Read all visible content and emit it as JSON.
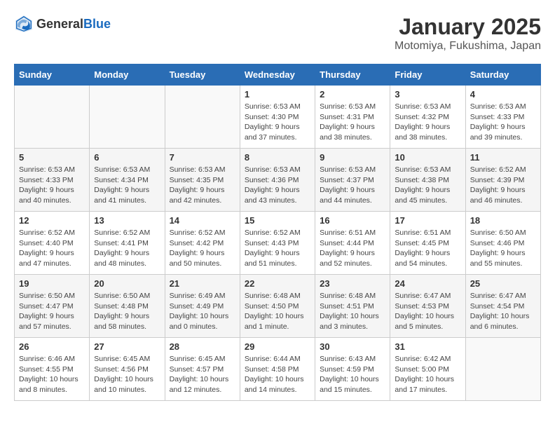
{
  "header": {
    "logo_general": "General",
    "logo_blue": "Blue",
    "month": "January 2025",
    "location": "Motomiya, Fukushima, Japan"
  },
  "days_of_week": [
    "Sunday",
    "Monday",
    "Tuesday",
    "Wednesday",
    "Thursday",
    "Friday",
    "Saturday"
  ],
  "weeks": [
    [
      {
        "day": "",
        "info": ""
      },
      {
        "day": "",
        "info": ""
      },
      {
        "day": "",
        "info": ""
      },
      {
        "day": "1",
        "info": "Sunrise: 6:53 AM\nSunset: 4:30 PM\nDaylight: 9 hours and 37 minutes."
      },
      {
        "day": "2",
        "info": "Sunrise: 6:53 AM\nSunset: 4:31 PM\nDaylight: 9 hours and 38 minutes."
      },
      {
        "day": "3",
        "info": "Sunrise: 6:53 AM\nSunset: 4:32 PM\nDaylight: 9 hours and 38 minutes."
      },
      {
        "day": "4",
        "info": "Sunrise: 6:53 AM\nSunset: 4:33 PM\nDaylight: 9 hours and 39 minutes."
      }
    ],
    [
      {
        "day": "5",
        "info": "Sunrise: 6:53 AM\nSunset: 4:33 PM\nDaylight: 9 hours and 40 minutes."
      },
      {
        "day": "6",
        "info": "Sunrise: 6:53 AM\nSunset: 4:34 PM\nDaylight: 9 hours and 41 minutes."
      },
      {
        "day": "7",
        "info": "Sunrise: 6:53 AM\nSunset: 4:35 PM\nDaylight: 9 hours and 42 minutes."
      },
      {
        "day": "8",
        "info": "Sunrise: 6:53 AM\nSunset: 4:36 PM\nDaylight: 9 hours and 43 minutes."
      },
      {
        "day": "9",
        "info": "Sunrise: 6:53 AM\nSunset: 4:37 PM\nDaylight: 9 hours and 44 minutes."
      },
      {
        "day": "10",
        "info": "Sunrise: 6:53 AM\nSunset: 4:38 PM\nDaylight: 9 hours and 45 minutes."
      },
      {
        "day": "11",
        "info": "Sunrise: 6:52 AM\nSunset: 4:39 PM\nDaylight: 9 hours and 46 minutes."
      }
    ],
    [
      {
        "day": "12",
        "info": "Sunrise: 6:52 AM\nSunset: 4:40 PM\nDaylight: 9 hours and 47 minutes."
      },
      {
        "day": "13",
        "info": "Sunrise: 6:52 AM\nSunset: 4:41 PM\nDaylight: 9 hours and 48 minutes."
      },
      {
        "day": "14",
        "info": "Sunrise: 6:52 AM\nSunset: 4:42 PM\nDaylight: 9 hours and 50 minutes."
      },
      {
        "day": "15",
        "info": "Sunrise: 6:52 AM\nSunset: 4:43 PM\nDaylight: 9 hours and 51 minutes."
      },
      {
        "day": "16",
        "info": "Sunrise: 6:51 AM\nSunset: 4:44 PM\nDaylight: 9 hours and 52 minutes."
      },
      {
        "day": "17",
        "info": "Sunrise: 6:51 AM\nSunset: 4:45 PM\nDaylight: 9 hours and 54 minutes."
      },
      {
        "day": "18",
        "info": "Sunrise: 6:50 AM\nSunset: 4:46 PM\nDaylight: 9 hours and 55 minutes."
      }
    ],
    [
      {
        "day": "19",
        "info": "Sunrise: 6:50 AM\nSunset: 4:47 PM\nDaylight: 9 hours and 57 minutes."
      },
      {
        "day": "20",
        "info": "Sunrise: 6:50 AM\nSunset: 4:48 PM\nDaylight: 9 hours and 58 minutes."
      },
      {
        "day": "21",
        "info": "Sunrise: 6:49 AM\nSunset: 4:49 PM\nDaylight: 10 hours and 0 minutes."
      },
      {
        "day": "22",
        "info": "Sunrise: 6:48 AM\nSunset: 4:50 PM\nDaylight: 10 hours and 1 minute."
      },
      {
        "day": "23",
        "info": "Sunrise: 6:48 AM\nSunset: 4:51 PM\nDaylight: 10 hours and 3 minutes."
      },
      {
        "day": "24",
        "info": "Sunrise: 6:47 AM\nSunset: 4:53 PM\nDaylight: 10 hours and 5 minutes."
      },
      {
        "day": "25",
        "info": "Sunrise: 6:47 AM\nSunset: 4:54 PM\nDaylight: 10 hours and 6 minutes."
      }
    ],
    [
      {
        "day": "26",
        "info": "Sunrise: 6:46 AM\nSunset: 4:55 PM\nDaylight: 10 hours and 8 minutes."
      },
      {
        "day": "27",
        "info": "Sunrise: 6:45 AM\nSunset: 4:56 PM\nDaylight: 10 hours and 10 minutes."
      },
      {
        "day": "28",
        "info": "Sunrise: 6:45 AM\nSunset: 4:57 PM\nDaylight: 10 hours and 12 minutes."
      },
      {
        "day": "29",
        "info": "Sunrise: 6:44 AM\nSunset: 4:58 PM\nDaylight: 10 hours and 14 minutes."
      },
      {
        "day": "30",
        "info": "Sunrise: 6:43 AM\nSunset: 4:59 PM\nDaylight: 10 hours and 15 minutes."
      },
      {
        "day": "31",
        "info": "Sunrise: 6:42 AM\nSunset: 5:00 PM\nDaylight: 10 hours and 17 minutes."
      },
      {
        "day": "",
        "info": ""
      }
    ]
  ]
}
